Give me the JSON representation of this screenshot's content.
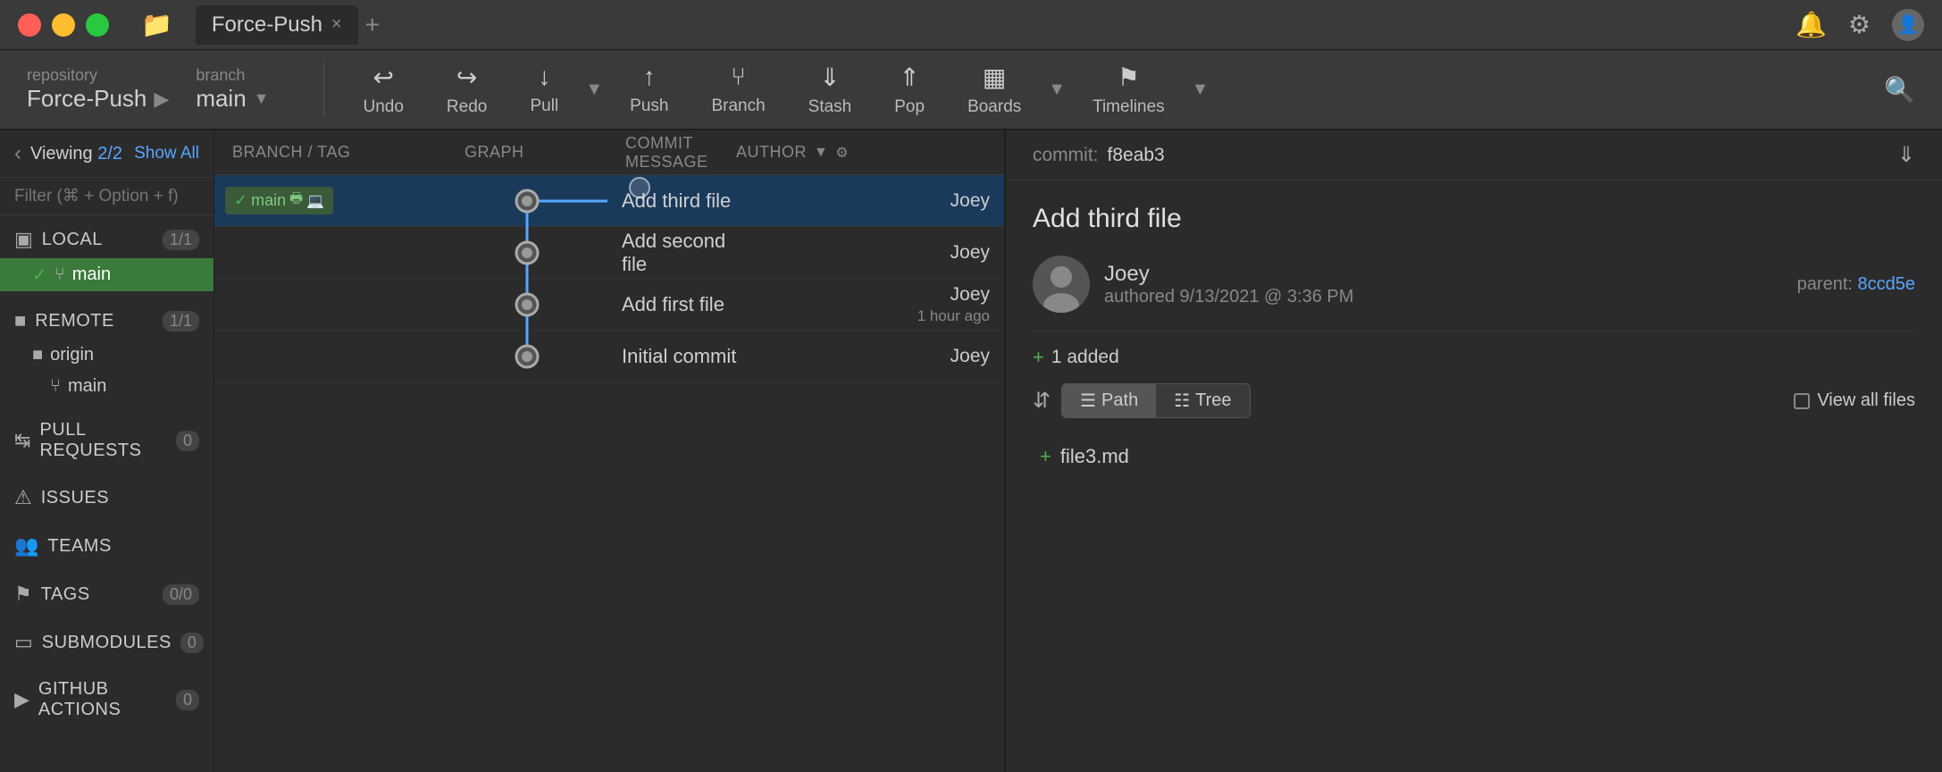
{
  "titlebar": {
    "tab_label": "Force-Push",
    "add_tab_label": "+",
    "close_tab_label": "×"
  },
  "repo": {
    "label": "repository",
    "name": "Force-Push",
    "branch_label": "branch",
    "branch_name": "main"
  },
  "toolbar": {
    "undo_label": "Undo",
    "redo_label": "Redo",
    "pull_label": "Pull",
    "push_label": "Push",
    "branch_label": "Branch",
    "stash_label": "Stash",
    "pop_label": "Pop",
    "boards_label": "Boards",
    "timelines_label": "Timelines"
  },
  "sidebar": {
    "viewing_text": "Viewing 2/2",
    "show_all_label": "Show All",
    "filter_placeholder": "Filter (⌘ + Option + f)",
    "sections": [
      {
        "id": "local",
        "label": "LOCAL",
        "count": "1/1",
        "icon": "▫"
      },
      {
        "id": "remote",
        "label": "REMOTE",
        "count": "1/1",
        "icon": "▫"
      },
      {
        "id": "pull-requests",
        "label": "PULL REQUESTS",
        "count": "0",
        "icon": "▫"
      },
      {
        "id": "issues",
        "label": "ISSUES",
        "count": "",
        "icon": "▫"
      },
      {
        "id": "teams",
        "label": "TEAMS",
        "count": "",
        "icon": "▫"
      },
      {
        "id": "tags",
        "label": "TAGS",
        "count": "0/0",
        "icon": "▫"
      },
      {
        "id": "submodules",
        "label": "SUBMODULES",
        "count": "0",
        "icon": "▫"
      },
      {
        "id": "github-actions",
        "label": "GITHUB ACTIONS",
        "count": "0",
        "icon": "▫"
      }
    ],
    "local_branches": [
      {
        "name": "main",
        "active": true
      }
    ],
    "remote_groups": [
      {
        "name": "origin",
        "branches": [
          "main"
        ]
      }
    ]
  },
  "commit_list": {
    "headers": {
      "branch_tag": "BRANCH / TAG",
      "graph": "GRAPH",
      "commit_message": "COMMIT MESSAGE",
      "author": "AUTHOR"
    },
    "commits": [
      {
        "id": 1,
        "branch_tag": "main",
        "message": "Add third file",
        "author": "Joey",
        "time": "",
        "selected": true
      },
      {
        "id": 2,
        "branch_tag": "",
        "message": "Add second file",
        "author": "Joey",
        "time": "",
        "selected": false
      },
      {
        "id": 3,
        "branch_tag": "",
        "message": "Add first file",
        "author": "Joey",
        "time": "",
        "selected": false
      },
      {
        "id": 4,
        "branch_tag": "",
        "message": "Initial commit",
        "author": "Joey",
        "time": "1 hour ago",
        "selected": false
      }
    ]
  },
  "right_panel": {
    "commit_hash_label": "commit:",
    "commit_hash": "f8eab3",
    "commit_title": "Add third file",
    "author_name": "Joey",
    "author_date": "authored  9/13/2021 @ 3:36 PM",
    "parent_label": "parent:",
    "parent_hash": "8ccd5e",
    "added_count": "1 added",
    "path_label": "Path",
    "tree_label": "Tree",
    "view_all_files_label": "View all files",
    "files": [
      {
        "name": "file3.md",
        "status": "added"
      }
    ]
  }
}
